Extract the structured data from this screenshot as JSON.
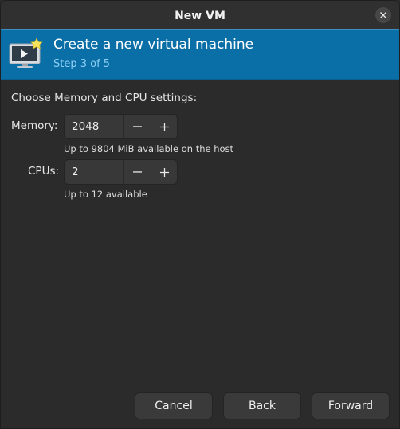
{
  "window": {
    "title": "New VM"
  },
  "banner": {
    "title": "Create a new virtual machine",
    "step": "Step 3 of 5"
  },
  "settings": {
    "heading": "Choose Memory and CPU settings:",
    "memory": {
      "label": "Memory:",
      "value": "2048",
      "hint": "Up to 9804 MiB available on the host"
    },
    "cpus": {
      "label": "CPUs:",
      "value": "2",
      "hint": "Up to 12 available"
    },
    "decrement_symbol": "−",
    "increment_symbol": "+"
  },
  "buttons": {
    "cancel": "Cancel",
    "back": "Back",
    "forward": "Forward"
  },
  "colors": {
    "banner_bg": "#0a6ea7",
    "step_text": "#8fd0f5",
    "window_bg": "#2b2b2b"
  },
  "icons": {
    "close": "close-icon",
    "banner": "vm-monitor-icon"
  }
}
